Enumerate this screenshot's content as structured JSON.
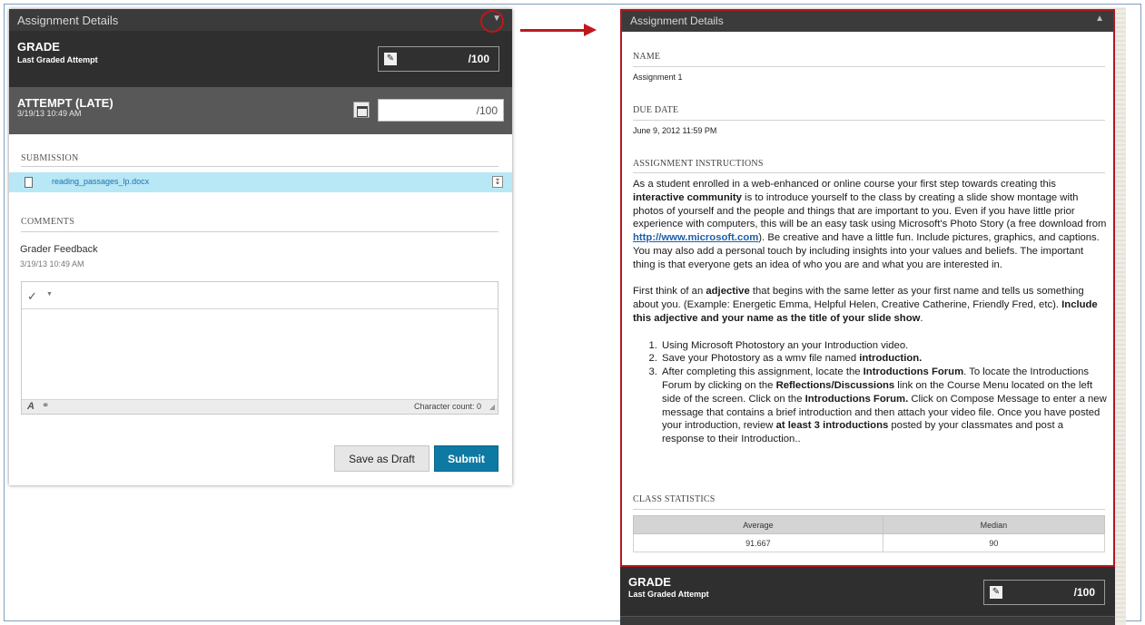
{
  "left_panel": {
    "header_title": "Assignment Details",
    "grade": {
      "title": "GRADE",
      "subtitle": "Last Graded Attempt",
      "value": "/100"
    },
    "attempt": {
      "title": "ATTEMPT (LATE)",
      "date": "3/19/13 10:49 AM",
      "value": "/100"
    },
    "submission": {
      "label": "SUBMISSION",
      "file_name": "reading_passages_lp.docx"
    },
    "comments": {
      "label": "COMMENTS",
      "feedback_title": "Grader Feedback",
      "feedback_date": "3/19/13 10:49 AM",
      "char_count": "Character count: 0"
    },
    "buttons": {
      "draft": "Save as Draft",
      "submit": "Submit"
    }
  },
  "right_panel": {
    "header_title": "Assignment Details",
    "name_label": "NAME",
    "name_value": "Assignment 1",
    "due_label": "DUE DATE",
    "due_value": "June 9, 2012 11:59 PM",
    "instructions_label": "ASSIGNMENT INSTRUCTIONS",
    "para1": {
      "a": "As a student enrolled in a web-enhanced or online course your first step towards creating this ",
      "b": "interactive community",
      "c": " is to introduce yourself to the class by creating a slide show montage with photos of yourself and the people and things that are important to you. Even if you have little prior experience with computers, this will be an easy task using Microsoft's Photo Story (a free download from ",
      "link": "http://www.microsoft.com",
      "d": "). Be creative and have a little fun. Include pictures, graphics, and captions. You may also add a personal touch by including insights into your values and beliefs. The important thing is that everyone gets an idea of who you are and what you are interested in."
    },
    "para2": {
      "a": "First think of an ",
      "b": "adjective",
      "c": " that begins with the same letter as your first name and tells us something about you. (Example: Energetic Emma, Helpful Helen, Creative Catherine, Friendly Fred, etc). ",
      "d": "Include this adjective and your name as the title of your slide show",
      "e": "."
    },
    "steps": {
      "s1": "Using Microsoft Photostory an your Introduction video.",
      "s2a": "Save your Photostory as a wmv file named ",
      "s2b": "introduction.",
      "s3a": "After completing this assignment, locate the ",
      "s3b": "Introductions Forum",
      "s3c": ". To locate the Introductions Forum by clicking on the ",
      "s3d": "Reflections/Discussions",
      "s3e": " link on the Course Menu located on the left side of the screen. Click on the ",
      "s3f": "Introductions Forum.",
      "s3g": " Click on Compose Message to enter a new message that contains a brief introduction and then attach your video file. Once you have posted your introduction, review ",
      "s3h": "at least 3 introductions",
      "s3i": " posted by your classmates and post a response to their Introduction.."
    },
    "stats_label": "CLASS STATISTICS",
    "stats": {
      "col1": "Average",
      "col2": "Median",
      "val1": "91.667",
      "val2": "90"
    },
    "grade": {
      "title": "GRADE",
      "subtitle": "Last Graded Attempt",
      "value": "/100"
    }
  },
  "colors": {
    "header_dark": "#3b3b3b",
    "accent_red": "#c0161c",
    "submit_blue": "#0e7aa4",
    "file_highlight": "#b8e8f5"
  }
}
